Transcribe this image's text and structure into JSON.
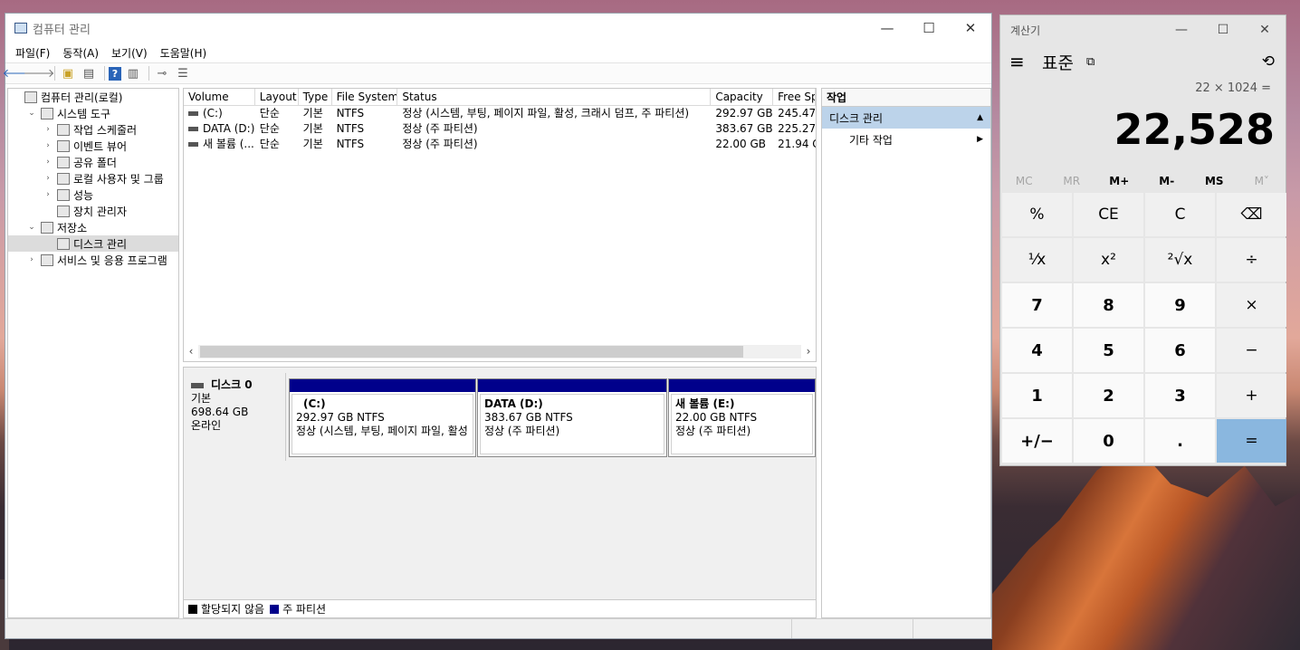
{
  "main_window": {
    "title": "컴퓨터 관리",
    "controls": {
      "minimize": "—",
      "maximize": "☐",
      "close": "✕"
    },
    "menu": [
      "파일(F)",
      "동작(A)",
      "보기(V)",
      "도움말(H)"
    ],
    "tree": [
      {
        "label": "컴퓨터 관리(로컬)",
        "indent": 0,
        "twisty": ""
      },
      {
        "label": "시스템 도구",
        "indent": 1,
        "twisty": "⌄"
      },
      {
        "label": "작업 스케줄러",
        "indent": 2,
        "twisty": "›"
      },
      {
        "label": "이벤트 뷰어",
        "indent": 2,
        "twisty": "›"
      },
      {
        "label": "공유 폴더",
        "indent": 2,
        "twisty": "›"
      },
      {
        "label": "로컬 사용자 및 그룹",
        "indent": 2,
        "twisty": "›"
      },
      {
        "label": "성능",
        "indent": 2,
        "twisty": "›"
      },
      {
        "label": "장치 관리자",
        "indent": 2,
        "twisty": ""
      },
      {
        "label": "저장소",
        "indent": 1,
        "twisty": "⌄"
      },
      {
        "label": "디스크 관리",
        "indent": 2,
        "twisty": ""
      },
      {
        "label": "서비스 및 응용 프로그램",
        "indent": 1,
        "twisty": "›"
      }
    ],
    "columns": [
      "Volume",
      "Layout",
      "Type",
      "File System",
      "Status",
      "Capacity",
      "Free Sp"
    ],
    "volumes": [
      [
        "(C:)",
        "단순",
        "기본",
        "NTFS",
        "정상 (시스템, 부팅, 페이지 파일, 활성, 크래시 덤프, 주 파티션)",
        "292.97 GB",
        "245.47"
      ],
      [
        "DATA (D:)",
        "단순",
        "기본",
        "NTFS",
        "정상 (주 파티션)",
        "383.67 GB",
        "225.27"
      ],
      [
        "새 볼륨 (...",
        "단순",
        "기본",
        "NTFS",
        "정상 (주 파티션)",
        "22.00 GB",
        "21.94 G"
      ]
    ],
    "disk": {
      "name": "디스크 0",
      "type": "기본",
      "size": "698.64 GB",
      "state": "온라인"
    },
    "partitions": [
      {
        "title": "(C:)",
        "size": "292.97 GB NTFS",
        "status": "정상 (시스템, 부팅, 페이지 파일, 활성"
      },
      {
        "title": "DATA  (D:)",
        "size": "383.67 GB NTFS",
        "status": "정상 (주 파티션)"
      },
      {
        "title": "새 볼륨  (E:)",
        "size": "22.00 GB NTFS",
        "status": "정상 (주 파티션)"
      }
    ],
    "legend": {
      "unallocated": "할당되지 않음",
      "primary": "주 파티션"
    },
    "actions": {
      "header": "작업",
      "section": "디스크 관리",
      "more": "기타 작업"
    }
  },
  "calculator": {
    "title": "계산기",
    "mode": "표준",
    "expression": "22 × 1024 =",
    "display": "22,528",
    "memory": [
      "MC",
      "MR",
      "M+",
      "M-",
      "MS",
      "M˅"
    ],
    "keys": [
      "%",
      "CE",
      "C",
      "⌫",
      "¹⁄x",
      "x²",
      "²√x",
      "÷",
      "7",
      "8",
      "9",
      "×",
      "4",
      "5",
      "6",
      "−",
      "1",
      "2",
      "3",
      "+",
      "+/−",
      "0",
      ".",
      "="
    ]
  },
  "colors": {
    "partition_bar": "#00008b",
    "unallocated": "#000000",
    "equals_key": "#8ab7df",
    "action_selected": "#bcd3ea"
  }
}
